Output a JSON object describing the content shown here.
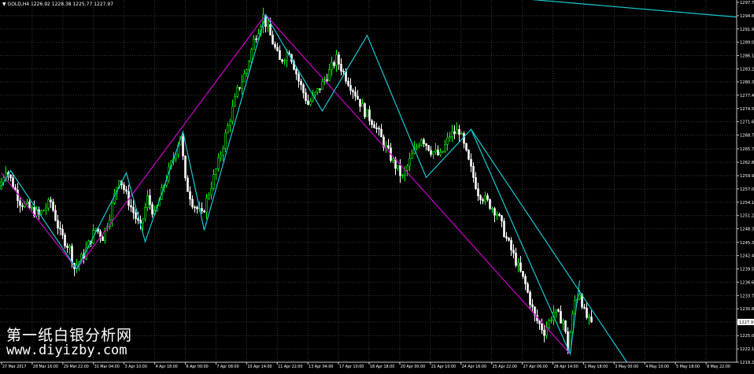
{
  "header": {
    "symbol": "GOLD,H4",
    "quote": "1226.92 1228.38 1225.77 1227.97"
  },
  "watermark": {
    "title": "第一纸白银分析网",
    "url": "www.diyizby.com"
  },
  "colors": {
    "background": "#000000",
    "grid": "#3a3a3a",
    "bull": "#00ff00",
    "bear": "#ffffff",
    "zigzag_magenta": "#cc00cc",
    "zigzag_cyan": "#19c8d2",
    "axis_text": "#ffffff",
    "current_price_box": "#ffffff"
  },
  "chart_data": {
    "type": "candlestick",
    "instrument": "GOLD",
    "timeframe": "H4",
    "y_axis": {
      "ticks": [
        "1297.70",
        "1294.80",
        "1291.90",
        "1289.00",
        "1286.10",
        "1283.20",
        "1280.35",
        "1277.45",
        "1274.55",
        "1271.65",
        "1268.75",
        "1265.75",
        "1262.80",
        "1259.90",
        "1257.00",
        "1254.10",
        "1251.20",
        "1248.30",
        "1245.35",
        "1242.45",
        "1239.55",
        "1236.65",
        "1233.75",
        "1230.85",
        "1227.97",
        "1225.00",
        "1222.10",
        "1219.20"
      ],
      "current_price": "1227.97"
    },
    "x_axis": {
      "ticks": [
        "27 Mar 2017",
        "28 Mar 16:00",
        "29 Mar 22:00",
        "31 Mar 04:00",
        "3 Apr 10:00",
        "4 Apr 18:00",
        "6 Apr 00:00",
        "7 Apr 08:00",
        "10 Apr 14:00",
        "11 Apr 22:00",
        "13 Apr 04:00",
        "17 Apr 10:00",
        "18 Apr 18:00",
        "20 Apr 00:00",
        "21 Apr 10:00",
        "24 Apr 16:00",
        "25 Apr 22:00",
        "27 Apr 06:00",
        "28 Apr 14:00",
        "1 May 18:00",
        "3 May 00:00",
        "4 May 10:00",
        "5 May 18:00",
        "8 May 22:00"
      ]
    },
    "price_path": [
      [
        0,
        1257.0
      ],
      [
        3,
        1261.5
      ],
      [
        9,
        1254.2
      ],
      [
        17,
        1251.3
      ],
      [
        22,
        1254.2
      ],
      [
        26,
        1247.2
      ],
      [
        30,
        1244.0
      ],
      [
        32,
        1239.7
      ],
      [
        36,
        1242.6
      ],
      [
        41,
        1248.4
      ],
      [
        44,
        1246.5
      ],
      [
        47,
        1251.3
      ],
      [
        51,
        1259.7
      ],
      [
        55,
        1254.2
      ],
      [
        60,
        1248.4
      ],
      [
        63,
        1255.0
      ],
      [
        66,
        1251.2
      ],
      [
        70,
        1258.0
      ],
      [
        74,
        1263.8
      ],
      [
        77,
        1268.8
      ],
      [
        79,
        1258.5
      ],
      [
        82,
        1254.1
      ],
      [
        86,
        1251.2
      ],
      [
        89,
        1256.2
      ],
      [
        93,
        1262.8
      ],
      [
        97,
        1270.6
      ],
      [
        101,
        1278.3
      ],
      [
        105,
        1283.1
      ],
      [
        108,
        1289.4
      ],
      [
        112,
        1294.6
      ],
      [
        116,
        1289.0
      ],
      [
        119,
        1284.8
      ],
      [
        123,
        1287.2
      ],
      [
        127,
        1280.6
      ],
      [
        131,
        1275.5
      ],
      [
        135,
        1278.3
      ],
      [
        139,
        1281.7
      ],
      [
        143,
        1285.4
      ],
      [
        147,
        1281.4
      ],
      [
        151,
        1277.8
      ],
      [
        155,
        1273.8
      ],
      [
        159,
        1271.2
      ],
      [
        163,
        1266.9
      ],
      [
        167,
        1262.9
      ],
      [
        171,
        1259.4
      ],
      [
        175,
        1264.3
      ],
      [
        179,
        1268.3
      ],
      [
        183,
        1265.4
      ],
      [
        187,
        1264.1
      ],
      [
        191,
        1268.7
      ],
      [
        195,
        1269.8
      ],
      [
        199,
        1262.8
      ],
      [
        203,
        1256.3
      ],
      [
        207,
        1254.1
      ],
      [
        211,
        1251.8
      ],
      [
        215,
        1246.1
      ],
      [
        219,
        1241.2
      ],
      [
        223,
        1236.1
      ],
      [
        227,
        1229.0
      ],
      [
        231,
        1225.9
      ],
      [
        235,
        1230.2
      ],
      [
        239,
        1228.3
      ],
      [
        241,
        1222.3
      ],
      [
        244,
        1232.6
      ],
      [
        246,
        1234.5
      ],
      [
        248,
        1230.0
      ],
      [
        250,
        1227.97
      ]
    ],
    "candle_count": 251,
    "zigzag_magenta": [
      [
        0,
        1260.5
      ],
      [
        32,
        1239.5
      ],
      [
        112,
        1295.0
      ],
      [
        241,
        1221.0
      ]
    ],
    "zigzag_cyan": [
      [
        0,
        1257.5
      ],
      [
        4,
        1261.0
      ],
      [
        32,
        1239.5
      ],
      [
        53,
        1260.5
      ],
      [
        61,
        1245.5
      ],
      [
        77,
        1269.5
      ],
      [
        86,
        1248.0
      ],
      [
        112,
        1295.0
      ],
      [
        136,
        1274.0
      ],
      [
        155,
        1290.5
      ],
      [
        180,
        1259.5
      ],
      [
        199,
        1270.0
      ],
      [
        241,
        1221.0
      ],
      [
        245,
        1237.0
      ]
    ],
    "trendlines": [
      {
        "color": "cyan",
        "from": [
          199,
          1270.0
        ],
        "to": [
          265,
          1219.2
        ]
      },
      {
        "color": "cyan",
        "from": [
          209,
          1299.0
        ],
        "to": [
          312,
          1294.5
        ]
      }
    ],
    "grid": true
  }
}
